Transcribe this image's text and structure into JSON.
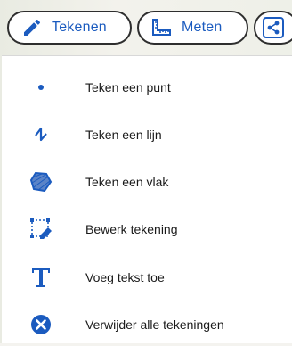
{
  "toolbar": {
    "draw": {
      "label": "Tekenen",
      "icon": "pencil-icon"
    },
    "measure": {
      "label": "Meten",
      "icon": "ruler-icon"
    },
    "share": {
      "icon": "share-icon"
    }
  },
  "menu": {
    "items": [
      {
        "label": "Teken een punt",
        "icon": "point-icon"
      },
      {
        "label": "Teken een lijn",
        "icon": "line-icon"
      },
      {
        "label": "Teken een vlak",
        "icon": "polygon-icon"
      },
      {
        "label": "Bewerk tekening",
        "icon": "edit-drawing-icon"
      },
      {
        "label": "Voeg tekst toe",
        "icon": "text-icon"
      },
      {
        "label": "Verwijder alle tekeningen",
        "icon": "delete-all-icon"
      }
    ]
  },
  "colors": {
    "accent": "#1b5bbf",
    "border": "#2e2e2e"
  }
}
